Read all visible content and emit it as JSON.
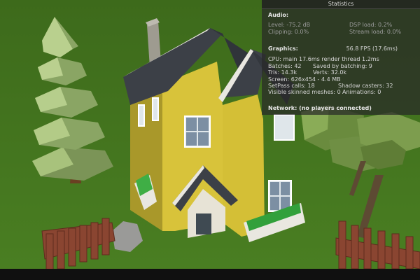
{
  "stats_panel": {
    "title": "Statistics",
    "audio": {
      "heading": "Audio:",
      "level": "Level: -75.2 dB",
      "dsp_load": "DSP load: 0.2%",
      "clipping": "Clipping: 0.0%",
      "stream_load": "Stream load: 0.0%"
    },
    "graphics": {
      "heading": "Graphics:",
      "fps": "56.8 FPS (17.6ms)",
      "cpu": "CPU: main 17.6ms  render thread 1.2ms",
      "batches": "Batches: 42",
      "saved_by_batching": "Saved by batching: 9",
      "tris": "Tris: 14.3k",
      "verts": "Verts: 32.0k",
      "screen": "Screen: 626x454 - 4.4 MB",
      "setpass": "SetPass calls: 18",
      "shadow_casters": "Shadow casters: 32",
      "skinned_meshes": "Visible skinned meshes: 0",
      "animations": "Animations: 0"
    },
    "network": {
      "line": "Network: (no players connected)"
    }
  },
  "colors": {
    "grass": "#3c6b1c",
    "house_wall": "#d8c33a",
    "roof": "#3b3f46",
    "tree": "#a9c27d",
    "fence": "#7a3d2e",
    "panel_bg": "#282828"
  },
  "icons": [
    "house-model",
    "pine-tree",
    "broadleaf-tree",
    "wooden-fence",
    "boulder",
    "flower-box"
  ]
}
